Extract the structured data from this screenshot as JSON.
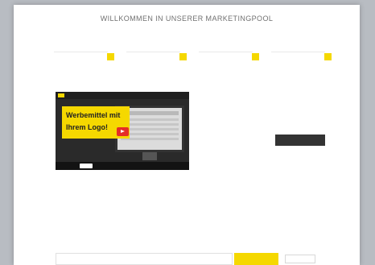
{
  "page": {
    "title": "WILLKOMMEN IN UNSERER MARKETINGPOOL"
  },
  "steps": [
    {
      "label": ""
    },
    {
      "label": ""
    },
    {
      "label": ""
    },
    {
      "label": ""
    }
  ],
  "intro": {
    "text": "",
    "strong": ""
  },
  "video": {
    "banner_line1": "Werbemittel mit",
    "banner_line2": "Ihrem Logo!"
  },
  "info": {
    "heading": "",
    "text": ""
  },
  "more_button": {
    "label": ""
  },
  "section": {
    "title": ""
  },
  "links": [],
  "search": {
    "placeholder": "",
    "button_label": "",
    "badge": ""
  },
  "colors": {
    "accent": "#f5d800",
    "dark_button": "#333333",
    "backdrop": "#b8bcc2",
    "play_button": "#e52d27"
  }
}
